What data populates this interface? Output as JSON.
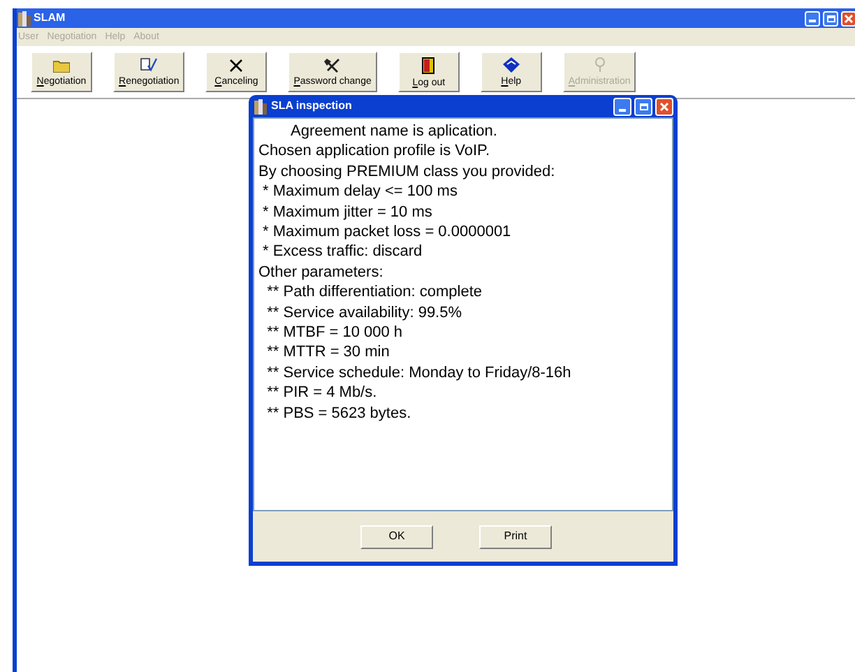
{
  "window": {
    "title": "SLAM"
  },
  "menu": [
    {
      "label": "User",
      "disabled": true
    },
    {
      "label": "Negotiation",
      "disabled": true
    },
    {
      "label": "Help",
      "disabled": true
    },
    {
      "label": "About",
      "disabled": true
    }
  ],
  "toolbar": [
    {
      "label": "Negotiation",
      "kind": "folder",
      "disabled": false
    },
    {
      "label": "Renegotiation",
      "kind": "edit",
      "disabled": false
    },
    {
      "label": "Canceling",
      "kind": "cross",
      "disabled": false
    },
    {
      "label": "Password change",
      "kind": "tools",
      "disabled": false
    },
    {
      "label": "Log out",
      "kind": "door",
      "disabled": false
    },
    {
      "label": "Help",
      "kind": "book",
      "disabled": false
    },
    {
      "label": "Administration",
      "kind": "admin",
      "disabled": true
    }
  ],
  "dialog": {
    "title": "SLA inspection",
    "lines": [
      {
        "text": "Agreement name is aplication.",
        "indent": true
      },
      {
        "text": "Chosen application profile is VoIP.",
        "indent": false
      },
      {
        "text": "By choosing PREMIUM class you provided:",
        "indent": false
      },
      {
        "text": " * Maximum delay <= 100 ms",
        "indent": false
      },
      {
        "text": " * Maximum jitter = 10 ms",
        "indent": false
      },
      {
        "text": " * Maximum packet loss = 0.0000001",
        "indent": false
      },
      {
        "text": " * Excess traffic: discard",
        "indent": false
      },
      {
        "text": "Other parameters:",
        "indent": false
      },
      {
        "text": "  ** Path differentiation: complete",
        "indent": false
      },
      {
        "text": "  ** Service availability: 99.5%",
        "indent": false
      },
      {
        "text": "  ** MTBF = 10 000 h",
        "indent": false
      },
      {
        "text": "  ** MTTR = 30 min",
        "indent": false
      },
      {
        "text": "  ** Service schedule: Monday to Friday/8-16h",
        "indent": false
      },
      {
        "text": "  ** PIR = 4 Mb/s.",
        "indent": false
      },
      {
        "text": "  ** PBS = 5623 bytes.",
        "indent": false
      }
    ],
    "buttons": [
      "OK",
      "Print"
    ]
  }
}
